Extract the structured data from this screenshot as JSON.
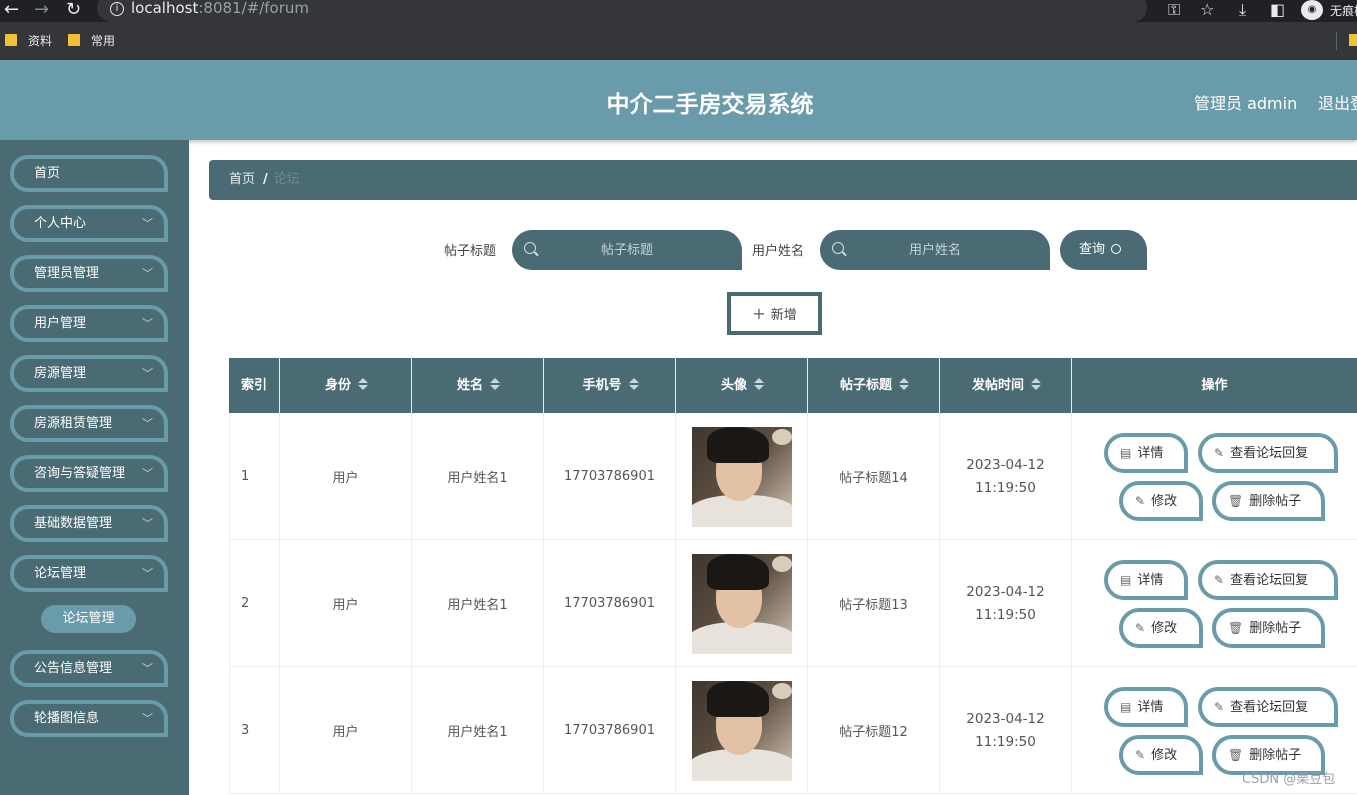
{
  "browser": {
    "url_host": "localhost",
    "url_rest": ":8081/#/forum",
    "incognito_label": "无痕模",
    "bookmarks": [
      "资料",
      "常用"
    ]
  },
  "header": {
    "title": "中介二手房交易系统",
    "admin": "管理员 admin",
    "logout": "退出登"
  },
  "sidebar": {
    "items": [
      {
        "label": "首页"
      },
      {
        "label": "个人中心"
      },
      {
        "label": "管理员管理"
      },
      {
        "label": "用户管理"
      },
      {
        "label": "房源管理"
      },
      {
        "label": "房源租赁管理"
      },
      {
        "label": "咨询与答疑管理"
      },
      {
        "label": "基础数据管理"
      },
      {
        "label": "论坛管理"
      },
      {
        "label": "公告信息管理"
      },
      {
        "label": "轮播图信息"
      }
    ],
    "active_sub": "论坛管理"
  },
  "breadcrumb": {
    "home": "首页",
    "separator": "/",
    "current": "论坛"
  },
  "search": {
    "title_label": "帖子标题",
    "title_placeholder": "帖子标题",
    "name_label": "用户姓名",
    "name_placeholder": "用户姓名",
    "query_label": "查询"
  },
  "add_label": "新增",
  "table": {
    "headers": [
      "索引",
      "身份",
      "姓名",
      "手机号",
      "头像",
      "帖子标题",
      "发帖时间",
      "操作"
    ],
    "rows": [
      {
        "index": "1",
        "role": "用户",
        "name": "用户姓名1",
        "phone": "17703786901",
        "title": "帖子标题14",
        "time": "2023-04-12 11:19:50"
      },
      {
        "index": "2",
        "role": "用户",
        "name": "用户姓名1",
        "phone": "17703786901",
        "title": "帖子标题13",
        "time": "2023-04-12 11:19:50"
      },
      {
        "index": "3",
        "role": "用户",
        "name": "用户姓名1",
        "phone": "17703786901",
        "title": "帖子标题12",
        "time": "2023-04-12 11:19:50"
      }
    ],
    "actions": {
      "detail": "详情",
      "replies": "查看论坛回复",
      "edit": "修改",
      "delete": "删除帖子"
    }
  },
  "watermark": "CSDN @栗豆包"
}
